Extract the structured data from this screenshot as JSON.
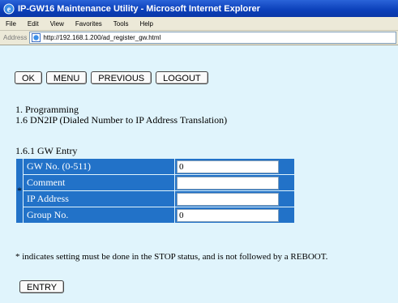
{
  "window": {
    "title": "IP-GW16 Maintenance Utility - Microsoft Internet Explorer"
  },
  "menu": {
    "items": [
      "File",
      "Edit",
      "View",
      "Favorites",
      "Tools",
      "Help"
    ]
  },
  "address": {
    "label": "Address",
    "url": "http://192.168.1.200/ad_register_gw.html"
  },
  "toolbar": {
    "ok": "OK",
    "menu": "MENU",
    "previous": "PREVIOUS",
    "logout": "LOGOUT"
  },
  "section": {
    "title": "1. Programming",
    "subtitle": "1.6 DN2IP (Dialed Number to IP Address Translation)",
    "subsection": "1.6.1 GW Entry"
  },
  "form": {
    "star": "*",
    "rows": [
      {
        "label": "GW No. (0-511)",
        "value": "0"
      },
      {
        "label": "Comment",
        "value": ""
      },
      {
        "label": "IP Address",
        "value": ""
      },
      {
        "label": "Group No.",
        "value": "0"
      }
    ]
  },
  "note": "* indicates setting must be done in the STOP status, and is not followed by a REBOOT.",
  "entry_button": "ENTRY",
  "colors": {
    "page_bg": "#e0f4fc",
    "table_blue": "#2272c8",
    "titlebar_blue": "#0b3fb9"
  }
}
